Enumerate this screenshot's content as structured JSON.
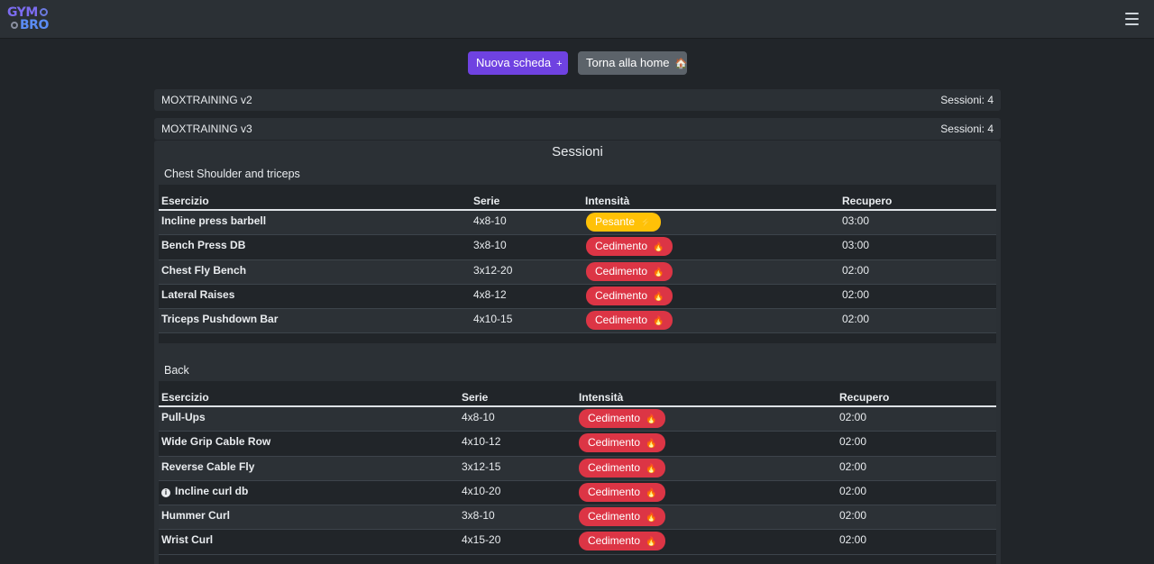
{
  "logo": {
    "line1": "GYM",
    "line2": "BRO"
  },
  "actions": {
    "new_label": "Nuova scheda",
    "new_icon": "+",
    "home_label": "Torna alla home",
    "home_icon": "🏠"
  },
  "plans": [
    {
      "name": "MOXTRAINING v2",
      "sessions": "Sessioni: 4"
    },
    {
      "name": "MOXTRAINING v3",
      "sessions": "Sessioni: 4"
    }
  ],
  "sessions_title": "Sessioni",
  "table_headers": {
    "exercise": "Esercizio",
    "series": "Serie",
    "intensity": "Intensità",
    "rest": "Recupero"
  },
  "sessions": [
    {
      "name": "Chest Shoulder and triceps",
      "rows": [
        {
          "exercise": "Incline press barbell",
          "series": "4x8-10",
          "intensity": "Pesante",
          "intensity_icon": "⚡",
          "rest": "03:00"
        },
        {
          "exercise": "Bench Press DB",
          "series": "3x8-10",
          "intensity": "Cedimento",
          "intensity_icon": "🔥",
          "rest": "03:00"
        },
        {
          "exercise": "Chest Fly Bench",
          "series": "3x12-20",
          "intensity": "Cedimento",
          "intensity_icon": "🔥",
          "rest": "02:00"
        },
        {
          "exercise": "Lateral Raises",
          "series": "4x8-12",
          "intensity": "Cedimento",
          "intensity_icon": "🔥",
          "rest": "02:00"
        },
        {
          "exercise": "Triceps Pushdown Bar",
          "series": "4x10-15",
          "intensity": "Cedimento",
          "intensity_icon": "🔥",
          "rest": "02:00"
        }
      ]
    },
    {
      "name": "Back",
      "rows": [
        {
          "exercise": "Pull-Ups",
          "series": "4x8-10",
          "intensity": "Cedimento",
          "intensity_icon": "🔥",
          "rest": "02:00"
        },
        {
          "exercise": "Wide Grip Cable Row",
          "series": "4x10-12",
          "intensity": "Cedimento",
          "intensity_icon": "🔥",
          "rest": "02:00"
        },
        {
          "exercise": "Reverse Cable Fly",
          "series": "3x12-15",
          "intensity": "Cedimento",
          "intensity_icon": "🔥",
          "rest": "02:00"
        },
        {
          "exercise": "Incline curl db",
          "series": "4x10-20",
          "intensity": "Cedimento",
          "intensity_icon": "🔥",
          "rest": "02:00",
          "info": "i"
        },
        {
          "exercise": "Hummer Curl",
          "series": "3x8-10",
          "intensity": "Cedimento",
          "intensity_icon": "🔥",
          "rest": "02:00"
        },
        {
          "exercise": "Wrist Curl",
          "series": "4x15-20",
          "intensity": "Cedimento",
          "intensity_icon": "🔥",
          "rest": "02:00"
        }
      ]
    }
  ],
  "colors": {
    "accent": "#6f42e1",
    "secondary": "#5c636a",
    "danger": "#dc3545",
    "warning": "#ffc107"
  }
}
